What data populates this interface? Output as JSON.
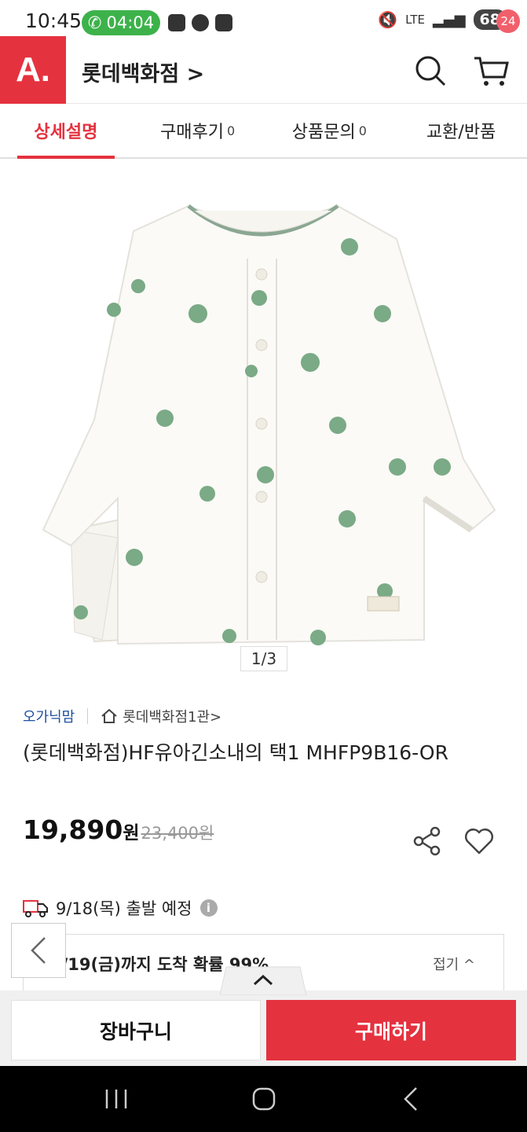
{
  "status_bar": {
    "time": "10:45",
    "call_timer": "04:04",
    "network": "LTE",
    "battery": "68"
  },
  "header": {
    "logo": "A.",
    "store_title": "롯데백화점 >",
    "cart_count": "24",
    "colors": {
      "brand": "#e5323f",
      "badge": "#f0606b"
    }
  },
  "tabs": [
    {
      "label": "상세설명",
      "count": ""
    },
    {
      "label": "구매후기",
      "count": "0"
    },
    {
      "label": "상품문의",
      "count": "0"
    },
    {
      "label": "교환/반품",
      "count": ""
    }
  ],
  "gallery": {
    "pager": "1/3"
  },
  "product": {
    "brand": "오가닉맘",
    "store_link": "롯데백화점1관>",
    "title": "(롯데백화점)HF유아긴소내의 택1 MHFP9B16-OR",
    "price": "19,890",
    "price_unit": "원",
    "original_price": "23,400원"
  },
  "shipping": {
    "departure": "9/18(목) 출발 예정",
    "info_icon": "i",
    "arrival": "9/19(금)까지 도착 확률 99%",
    "fold_label": "접기 ^"
  },
  "actions": {
    "cart_label": "장바구니",
    "buy_label": "구매하기"
  }
}
